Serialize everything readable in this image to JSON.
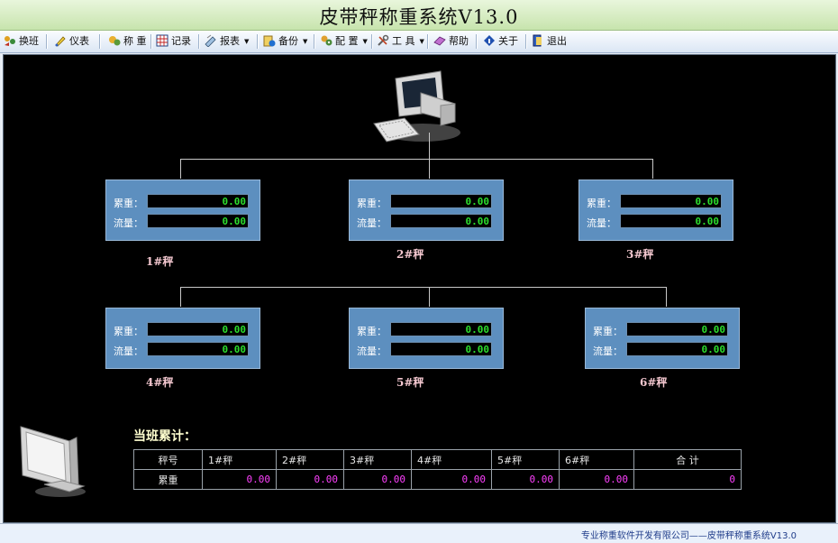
{
  "window": {
    "title": "皮带秤称重系统V13.0"
  },
  "toolbar": {
    "items": [
      {
        "label": "换班",
        "icon": "people-swap-icon"
      },
      {
        "label": "仪表",
        "icon": "meter-icon"
      },
      {
        "label": "称 重",
        "icon": "scale-icon"
      },
      {
        "label": "记录",
        "icon": "grid-icon"
      },
      {
        "label": "报表",
        "icon": "report-icon",
        "dropdown": true
      },
      {
        "label": "备份",
        "icon": "backup-icon",
        "dropdown": true
      },
      {
        "label": "配 置",
        "icon": "config-icon",
        "dropdown": true
      },
      {
        "label": "工 具",
        "icon": "tools-icon",
        "dropdown": true
      },
      {
        "label": "帮助",
        "icon": "help-book-icon"
      },
      {
        "label": "关于",
        "icon": "info-icon"
      },
      {
        "label": "退出",
        "icon": "exit-door-icon"
      }
    ]
  },
  "scales": [
    {
      "name": "1#秤",
      "cumulative_label": "累重：",
      "cumulative": "0.00",
      "flow_label": "流量：",
      "flow": "0.00"
    },
    {
      "name": "2#秤",
      "cumulative_label": "累重：",
      "cumulative": "0.00",
      "flow_label": "流量：",
      "flow": "0.00"
    },
    {
      "name": "3#秤",
      "cumulative_label": "累重：",
      "cumulative": "0.00",
      "flow_label": "流量：",
      "flow": "0.00"
    },
    {
      "name": "4#秤",
      "cumulative_label": "累重：",
      "cumulative": "0.00",
      "flow_label": "流量：",
      "flow": "0.00"
    },
    {
      "name": "5#秤",
      "cumulative_label": "累重：",
      "cumulative": "0.00",
      "flow_label": "流量：",
      "flow": "0.00"
    },
    {
      "name": "6#秤",
      "cumulative_label": "累重：",
      "cumulative": "0.00",
      "flow_label": "流量：",
      "flow": "0.00"
    }
  ],
  "shift_totals": {
    "title": "当班累计：",
    "headers": [
      "秤号",
      "1#秤",
      "2#秤",
      "3#秤",
      "4#秤",
      "5#秤",
      "6#秤",
      "合        计"
    ],
    "row": [
      "累重",
      "0.00",
      "0.00",
      "0.00",
      "0.00",
      "0.00",
      "0.00",
      "0"
    ]
  },
  "status": {
    "text": "专业称重软件开发有限公司——皮带秤称重系统V13.0"
  },
  "colors": {
    "value_text": "#2dde2d",
    "panel": "#5d8fbf",
    "total_value": "#ff40ff",
    "scale_name": "#f3c7cf"
  }
}
